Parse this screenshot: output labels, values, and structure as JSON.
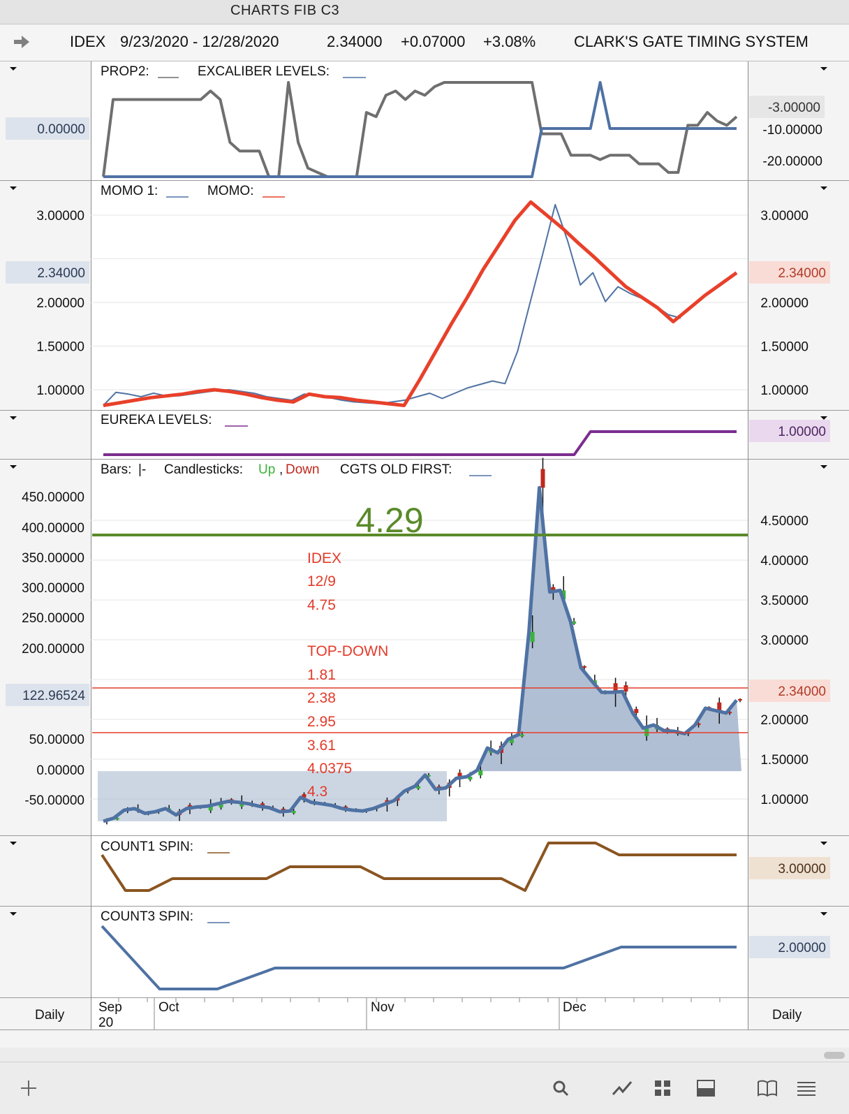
{
  "window_title": "CHARTS FIB C3",
  "header": {
    "symbol": "IDEX",
    "date_range": "9/23/2020 - 12/28/2020",
    "price": "2.34000",
    "change": "+0.07000",
    "change_pct": "+3.08%",
    "system_name": "CLARK'S GATE TIMING SYSTEM"
  },
  "panels": {
    "prop2": {
      "legend1": "PROP2:",
      "legend2": "EXCALIBER LEVELS:",
      "left_value": "0.00000",
      "right_ticks": [
        "-3.00000",
        "-10.00000",
        "-20.00000"
      ]
    },
    "momo": {
      "legend1": "MOMO 1:",
      "legend2": "MOMO:",
      "ticks": [
        "3.00000",
        "2.00000",
        "1.50000",
        "1.00000"
      ],
      "left_value": "2.34000",
      "right_value": "2.34000"
    },
    "eureka": {
      "legend": "EUREKA LEVELS:",
      "right_value": "1.00000"
    },
    "price": {
      "legend_bars": "Bars:",
      "legend_bars_sym": "|-",
      "legend_candles": "Candlesticks:",
      "legend_up": "Up",
      "legend_comma": ",",
      "legend_down": "Down",
      "legend_cgts": "CGTS OLD FIRST:",
      "left_ticks": [
        "450.00000",
        "400.00000",
        "350.00000",
        "300.00000",
        "250.00000",
        "200.00000",
        "50.00000",
        "0.00000",
        "-50.00000"
      ],
      "left_value": "122.96524",
      "right_ticks": [
        "4.50000",
        "4.00000",
        "3.50000",
        "3.00000",
        "2.00000",
        "1.50000",
        "1.00000"
      ],
      "right_value": "2.34000",
      "big_label": "4.29",
      "annotations": [
        "IDEX",
        "12/9",
        "4.75",
        "TOP-DOWN",
        "1.81",
        "2.38",
        "2.95",
        "3.61",
        "4.0375",
        "4.3"
      ]
    },
    "count1": {
      "legend": "COUNT1 SPIN:",
      "right_value": "3.00000"
    },
    "count3": {
      "legend": "COUNT3 SPIN:",
      "right_value": "2.00000"
    }
  },
  "time_axis": {
    "left_label": "Daily",
    "right_label": "Daily",
    "months": [
      "Sep",
      "Oct",
      "Nov",
      "Dec"
    ],
    "year": "20"
  },
  "colors": {
    "blue": "#4f72a3",
    "gray": "#6f6f6f",
    "red": "#e8402a",
    "purple": "#7b2d8e",
    "brown": "#8a5521",
    "green": "#5a8a2a",
    "fill": "#a3b4cc",
    "candle_up": "#3bb33b",
    "candle_down": "#c0281e"
  },
  "chart_data": [
    {
      "type": "line",
      "title": "PROP2 / EXCALIBER LEVELS",
      "series": [
        {
          "name": "PROP2",
          "values": [
            -22,
            -4,
            -4,
            -4,
            -4,
            -4,
            -4,
            -4,
            -4,
            -4,
            -4,
            -2,
            -4,
            -14,
            -16,
            -16,
            -16,
            -22,
            -22,
            0,
            -14,
            -20,
            -21,
            -22,
            -22,
            -22,
            -22,
            -7,
            -8,
            -3,
            -2,
            -4,
            -2,
            -3,
            -1,
            0,
            0,
            0,
            0,
            0,
            0,
            0,
            0,
            0,
            0,
            -12,
            -12,
            -12,
            -17,
            -17,
            -17,
            -18,
            -17,
            -17,
            -17,
            -19,
            -19,
            -19,
            -21,
            -21,
            -10,
            -10,
            -7,
            -9,
            -10,
            -8
          ]
        },
        {
          "name": "EXCALIBER LEVELS",
          "values": [
            -22,
            -22,
            -22,
            -22,
            -22,
            -22,
            -22,
            -22,
            -22,
            -22,
            -22,
            -22,
            -22,
            -22,
            -22,
            -22,
            -22,
            -22,
            -22,
            -22,
            -22,
            -22,
            -22,
            -22,
            -22,
            -22,
            -22,
            -22,
            -22,
            -22,
            -22,
            -22,
            -22,
            -22,
            -22,
            -22,
            -22,
            -22,
            -22,
            -22,
            -22,
            -22,
            -22,
            -22,
            -22,
            -10,
            -10,
            -10,
            -10,
            -10,
            -10,
            0,
            -10,
            -10,
            -10,
            -10,
            -10,
            -10,
            -10,
            -10,
            -10,
            -10,
            -10,
            -10,
            -10,
            -10
          ]
        }
      ]
    },
    {
      "type": "line",
      "title": "MOMO",
      "series": [
        {
          "name": "MOMO 1",
          "values": [
            0.82,
            0.97,
            0.95,
            0.92,
            0.96,
            0.93,
            0.93,
            0.95,
            0.97,
            0.99,
            1.0,
            0.98,
            0.96,
            0.92,
            0.9,
            0.88,
            0.95,
            0.93,
            0.91,
            0.88,
            0.86,
            0.85,
            0.84,
            0.86,
            0.88,
            0.92,
            0.96,
            0.9,
            0.96,
            1.02,
            1.06,
            1.1,
            1.07,
            1.44,
            2.0,
            2.55,
            3.12,
            2.7,
            2.2,
            2.34,
            2.01,
            2.18,
            2.1,
            2.04,
            1.96,
            1.86,
            1.82
          ]
        },
        {
          "name": "MOMO",
          "values": [
            0.82,
            0.85,
            0.88,
            0.91,
            0.93,
            0.95,
            0.98,
            1.0,
            0.98,
            0.95,
            0.91,
            0.88,
            0.86,
            0.95,
            0.92,
            0.91,
            0.88,
            0.86,
            0.84,
            0.82,
            1.12,
            1.44,
            1.76,
            2.06,
            2.38,
            2.66,
            2.94,
            3.15,
            3.0,
            2.85,
            2.68,
            2.52,
            2.35,
            2.18,
            2.06,
            1.94,
            1.78,
            1.93,
            2.08,
            2.21,
            2.34
          ]
        }
      ]
    },
    {
      "type": "line",
      "title": "EUREKA LEVELS",
      "series": [
        {
          "name": "EUREKA LEVELS",
          "values": [
            0,
            0,
            0,
            0,
            0,
            0,
            0,
            0,
            0,
            0,
            0,
            0,
            0,
            0,
            0,
            0,
            0,
            0,
            0,
            0,
            0,
            0,
            0,
            0,
            0,
            0,
            0,
            0,
            0,
            0,
            1,
            1,
            1,
            1,
            1,
            1,
            1,
            1,
            1,
            1
          ]
        }
      ]
    },
    {
      "type": "line",
      "title": "Price",
      "ylim": [
        0.72,
        4.95
      ],
      "series": [
        {
          "name": "CGTS OLD FIRST",
          "values": [
            0.72,
            0.76,
            0.86,
            0.88,
            0.82,
            0.84,
            0.88,
            0.8,
            0.88,
            0.9,
            0.91,
            0.94,
            0.97,
            0.96,
            0.94,
            0.91,
            0.89,
            0.84,
            0.85,
            1.02,
            0.96,
            0.94,
            0.92,
            0.88,
            0.86,
            0.85,
            0.88,
            0.93,
            0.98,
            1.1,
            1.16,
            1.3,
            1.12,
            1.14,
            1.26,
            1.28,
            1.36,
            1.64,
            1.58,
            1.75,
            1.81,
            3.1,
            4.91,
            3.6,
            3.62,
            3.23,
            2.65,
            2.49,
            2.34,
            2.34,
            2.35,
            2.08,
            1.89,
            1.93,
            1.86,
            1.85,
            1.82,
            1.93,
            2.14,
            2.11,
            2.08,
            2.24
          ]
        }
      ]
    },
    {
      "type": "line",
      "title": "COUNT1 SPIN",
      "series": [
        {
          "name": "COUNT1 SPIN",
          "values": [
            4.0,
            1.0,
            1.0,
            2.0,
            2.0,
            2.0,
            2.0,
            2.0,
            3.0,
            3.0,
            3.0,
            3.0,
            2.0,
            2.0,
            2.0,
            2.0,
            2.0,
            2.0,
            1.0,
            5.0,
            5.0,
            5.0,
            4.0,
            4.0,
            4.0,
            4.0,
            4.0,
            4.0
          ]
        }
      ]
    },
    {
      "type": "line",
      "title": "COUNT3 SPIN",
      "series": [
        {
          "name": "COUNT3 SPIN",
          "values": [
            3.0,
            0.0,
            0.0,
            1.0,
            1.0,
            1.0,
            1.0,
            1.0,
            1.0,
            2.0,
            2.0,
            2.0
          ]
        }
      ]
    }
  ]
}
